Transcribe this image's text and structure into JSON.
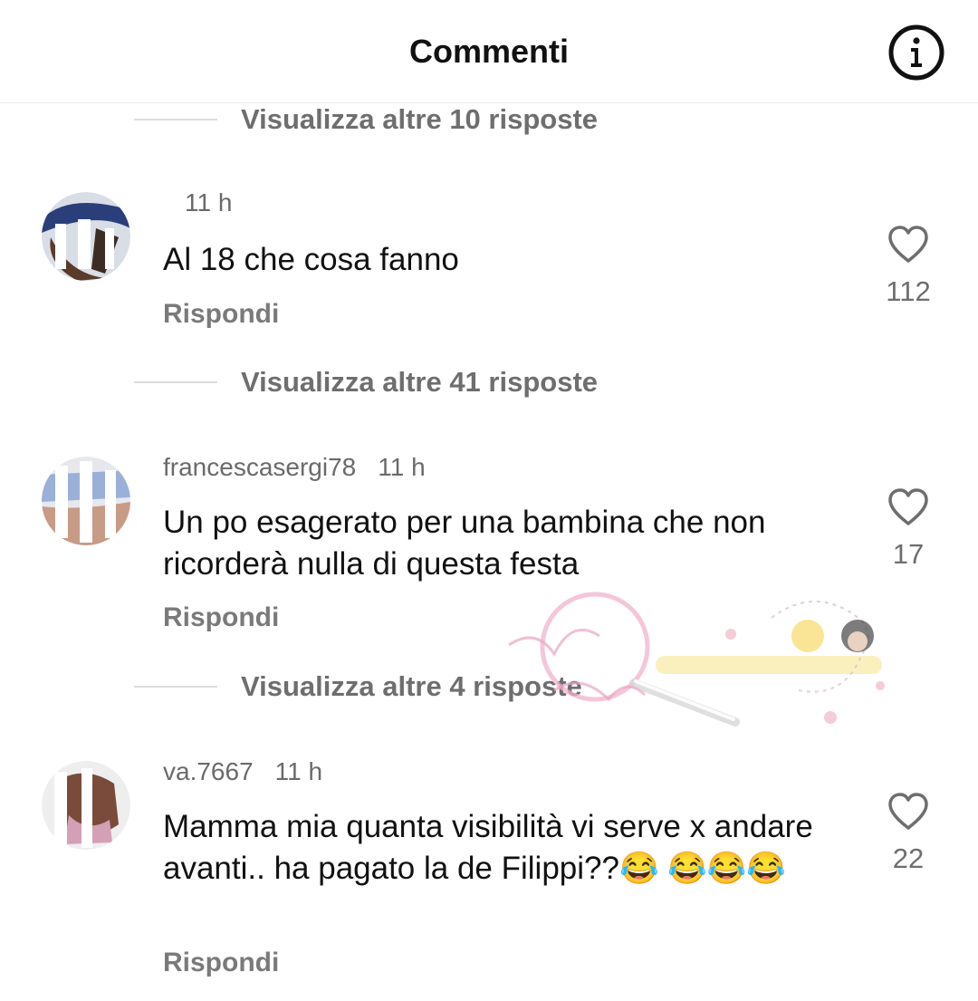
{
  "header": {
    "title": "Commenti",
    "info_icon": "info-icon"
  },
  "threads": [
    {
      "view_more": "Visualizza altre 10 risposte"
    },
    {
      "username": "",
      "time": "11 h",
      "text": "Al 18 che cosa fanno",
      "reply": "Rispondi",
      "likes": "112",
      "view_more": "Visualizza altre 41 risposte"
    },
    {
      "username": "francescasergi78",
      "time": "11 h",
      "text": "Un po esagerato per una bambina che non ricorderà nulla di questa  festa",
      "reply": "Rispondi",
      "likes": "17",
      "view_more": "Visualizza altre 4 risposte"
    },
    {
      "username": "va.7667",
      "time": "11 h",
      "text": "Mamma mia quanta visibilità vi serve x andare avanti.. ha pagato la de Filippi??😂 😂😂😂",
      "reply": "Rispondi",
      "likes": "22"
    }
  ],
  "colors": {
    "text": "#111111",
    "secondary": "#6e6e6e",
    "divider": "#dcdcdc"
  }
}
